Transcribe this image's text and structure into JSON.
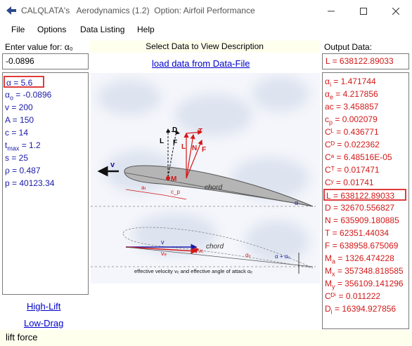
{
  "window": {
    "title": "CALQLATA's   Aerodynamics (1.2)  Option: Airfoil Performance"
  },
  "menu": [
    "File",
    "Options",
    "Data Listing",
    "Help"
  ],
  "left_panel": {
    "label": "Enter value for: α₀",
    "input_value": "-0.0896",
    "params": [
      {
        "sym": "α",
        "sub": "",
        "val": " = 5.6"
      },
      {
        "sym": "α",
        "sub": "o",
        "val": " = -0.0896"
      },
      {
        "sym": "v",
        "sub": "",
        "val": " = 200"
      },
      {
        "sym": "A",
        "sub": "",
        "val": " = 150"
      },
      {
        "sym": "c",
        "sub": "",
        "val": " = 14"
      },
      {
        "sym": "t",
        "sub": "max",
        "val": " = 1.2"
      },
      {
        "sym": "s",
        "sub": "",
        "val": " = 25"
      },
      {
        "sym": "ρ",
        "sub": "",
        "val": " = 0.487"
      },
      {
        "sym": "p",
        "sub": "",
        "val": " = 40123.34"
      }
    ],
    "links": [
      "High-Lift",
      "Low-Drag"
    ]
  },
  "center": {
    "header": "Select Data to View Description",
    "load_link": "load data from Data-File",
    "diagram_labels": {
      "D": "D",
      "L": "L",
      "F": "F",
      "N": "N",
      "T": "T",
      "L2": "L",
      "F2": "F",
      "M": "M",
      "v": "v",
      "chord": "chord",
      "ac": "aₜ",
      "cp": "c_p",
      "alpha": "α",
      "v2": "v",
      "ve": "vₑ",
      "wi": "wᵢ",
      "chord2": "chord",
      "alpha_e": "αₑ",
      "alpha_sum": "α + α₀",
      "caption": "effective velocity vₑ and effective angle of attack αₑ"
    }
  },
  "right_panel": {
    "label": "Output Data:",
    "output_value": "L = 638122.89033",
    "results": [
      {
        "sym": "α",
        "sub": "i",
        "val": " = 1.471744"
      },
      {
        "sym": "α",
        "sub": "e",
        "val": " = 4.217856"
      },
      {
        "sym": "ac",
        "sub": "",
        "val": " = 3.458857"
      },
      {
        "sym": "c",
        "sub": "p",
        "val": " = 0.002079"
      },
      {
        "sym": "Cᴸ",
        "sub": "",
        "val": " = 0.436771"
      },
      {
        "sym": "Cᴰ",
        "sub": "",
        "val": " = 0.022362"
      },
      {
        "sym": "Cᵃ",
        "sub": "",
        "val": " = 6.48516E-05"
      },
      {
        "sym": "Cᵀ",
        "sub": "",
        "val": " = 0.017471"
      },
      {
        "sym": "Cʸ",
        "sub": "",
        "val": " = 0.01741"
      },
      {
        "sym": "L",
        "sub": "",
        "val": " = 638122.89033"
      },
      {
        "sym": "D",
        "sub": "",
        "val": " = 32670.556827"
      },
      {
        "sym": "N",
        "sub": "",
        "val": " = 635909.180885"
      },
      {
        "sym": "T",
        "sub": "",
        "val": " = 62351.44034"
      },
      {
        "sym": "F",
        "sub": "",
        "val": " = 638958.675069"
      },
      {
        "sym": "M",
        "sub": "a",
        "val": " = 1326.474228"
      },
      {
        "sym": "M",
        "sub": "x",
        "val": " = 357348.818585"
      },
      {
        "sym": "M",
        "sub": "y",
        "val": " = 356109.141296"
      },
      {
        "sym": "Cᴰⁱ",
        "sub": "",
        "val": " = 0.011222"
      },
      {
        "sym": "D",
        "sub": "i",
        "val": " = 16394.927856"
      }
    ]
  },
  "status_text": "lift force",
  "colors": {
    "param_blue": "#1a1aa8",
    "result_red": "#d31919",
    "highlight": "#e03c3c",
    "pale_yellow": "#ffffee"
  }
}
